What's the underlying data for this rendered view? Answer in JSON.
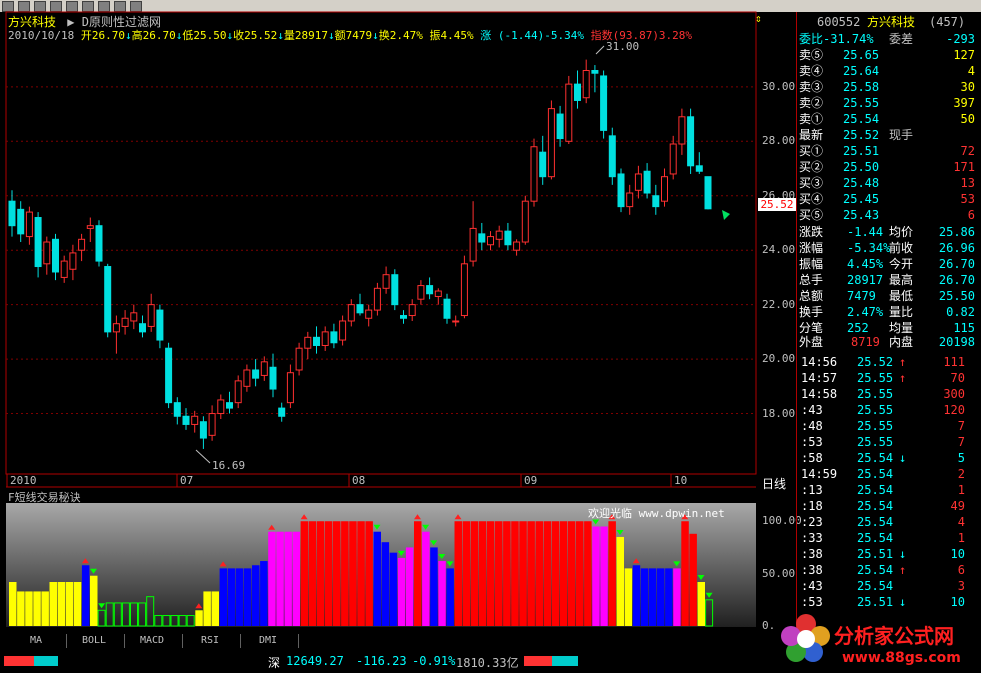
{
  "window": {
    "stock_name": "方兴科技",
    "formula": "D原则性过滤网"
  },
  "info_line": {
    "date": "2010/10/18",
    "open": "开26.70",
    "high": "高26.70",
    "low": "低25.50",
    "close": "收25.52",
    "volume": "量28917",
    "amount": "额7479",
    "turnover": "换2.47%",
    "amplitude": "振4.45%",
    "change": "涨 (-1.44)-5.34%",
    "index_label": "指数",
    "index_value": "(93.87)3.28%"
  },
  "price_axis": [
    "30.00",
    "28.00",
    "26.00",
    "24.00",
    "22.00",
    "20.00",
    "18.00"
  ],
  "price_marker": "25.52",
  "annotations": {
    "high": "31.00",
    "low": "16.69"
  },
  "date_axis": [
    "2010",
    "07",
    "08",
    "09",
    "10"
  ],
  "period_label": "日线",
  "indicator": {
    "title": "F短线交易秘诀",
    "watermark": "欢迎光临 www.dpwin.net",
    "axis": [
      "100.00",
      "50.00",
      "0."
    ]
  },
  "tabs": [
    "MA",
    "BOLL",
    "MACD",
    "RSI",
    "DMI"
  ],
  "panel": {
    "code": "600552",
    "name": "方兴科技",
    "count": "(457)",
    "weibi": "委比-31.74%",
    "weicha_label": "委差",
    "weicha": "-293",
    "sells": [
      {
        "label": "卖⑤",
        "price": "25.65",
        "vol": "127"
      },
      {
        "label": "卖④",
        "price": "25.64",
        "vol": "4"
      },
      {
        "label": "卖③",
        "price": "25.58",
        "vol": "30"
      },
      {
        "label": "卖②",
        "price": "25.55",
        "vol": "397"
      },
      {
        "label": "卖①",
        "price": "25.54",
        "vol": "50"
      }
    ],
    "latest_label": "最新",
    "latest": "25.52",
    "xianshou": "现手",
    "buys": [
      {
        "label": "买①",
        "price": "25.51",
        "vol": "72"
      },
      {
        "label": "买②",
        "price": "25.50",
        "vol": "171"
      },
      {
        "label": "买③",
        "price": "25.48",
        "vol": "13"
      },
      {
        "label": "买④",
        "price": "25.45",
        "vol": "53"
      },
      {
        "label": "买⑤",
        "price": "25.43",
        "vol": "6"
      }
    ],
    "stats": [
      [
        "涨跌",
        "-1.44",
        "均价",
        "25.86"
      ],
      [
        "涨幅",
        "-5.34%",
        "前收",
        "26.96"
      ],
      [
        "振幅",
        "4.45%",
        "今开",
        "26.70"
      ],
      [
        "总手",
        "28917",
        "最高",
        "26.70"
      ],
      [
        "总额",
        "7479",
        "最低",
        "25.50"
      ],
      [
        "换手",
        "2.47%",
        "量比",
        "0.82"
      ],
      [
        "分笔",
        "252",
        "均量",
        "115"
      ]
    ],
    "outer_label": "外盘",
    "outer": "8719",
    "inner_label": "内盘",
    "inner": "20198",
    "ticks": [
      {
        "t": "14:56",
        "p": "25.52",
        "a": "↑",
        "v": "111"
      },
      {
        "t": "14:57",
        "p": "25.55",
        "a": "↑",
        "v": "70"
      },
      {
        "t": "14:58",
        "p": "25.55",
        "a": "",
        "v": "300"
      },
      {
        "t": ":43",
        "p": "25.55",
        "a": "",
        "v": "120"
      },
      {
        "t": ":48",
        "p": "25.55",
        "a": "",
        "v": "7"
      },
      {
        "t": ":53",
        "p": "25.55",
        "a": "",
        "v": "7"
      },
      {
        "t": ":58",
        "p": "25.54",
        "a": "↓",
        "v": "5"
      },
      {
        "t": "14:59",
        "p": "25.54",
        "a": "",
        "v": "2"
      },
      {
        "t": ":13",
        "p": "25.54",
        "a": "",
        "v": "1"
      },
      {
        "t": ":18",
        "p": "25.54",
        "a": "",
        "v": "49"
      },
      {
        "t": ":23",
        "p": "25.54",
        "a": "",
        "v": "4"
      },
      {
        "t": ":33",
        "p": "25.54",
        "a": "",
        "v": "1"
      },
      {
        "t": ":38",
        "p": "25.51",
        "a": "↓",
        "v": "10"
      },
      {
        "t": ":38",
        "p": "25.54",
        "a": "↑",
        "v": "6"
      },
      {
        "t": ":43",
        "p": "25.54",
        "a": "",
        "v": "3"
      },
      {
        "t": ":53",
        "p": "25.51",
        "a": "↓",
        "v": "10"
      }
    ]
  },
  "status": {
    "market": "深",
    "index": "12649.27",
    "change": "-116.23",
    "pct": "-0.91%",
    "amount": "1810.33亿"
  },
  "logo": {
    "text": "分析家公式网",
    "url": "www.88gs.com"
  },
  "chart_data": {
    "type": "candlestick",
    "ylim": [
      16,
      31.5
    ],
    "candles": [
      [
        25.8,
        26.2,
        24.5,
        24.9
      ],
      [
        25.5,
        25.8,
        24.3,
        24.6
      ],
      [
        24.5,
        25.6,
        24.2,
        25.4
      ],
      [
        25.2,
        25.4,
        23.0,
        23.4
      ],
      [
        23.5,
        24.5,
        23.1,
        24.3
      ],
      [
        24.4,
        24.6,
        22.9,
        23.2
      ],
      [
        23.0,
        23.8,
        22.8,
        23.6
      ],
      [
        23.3,
        24.2,
        22.9,
        23.9
      ],
      [
        24.0,
        24.6,
        23.6,
        24.4
      ],
      [
        24.8,
        25.2,
        24.3,
        24.9
      ],
      [
        24.9,
        25.1,
        23.4,
        23.6
      ],
      [
        23.4,
        23.5,
        20.8,
        21.0
      ],
      [
        21.0,
        21.6,
        20.2,
        21.3
      ],
      [
        21.2,
        21.8,
        20.9,
        21.5
      ],
      [
        21.4,
        22.0,
        21.1,
        21.7
      ],
      [
        21.3,
        21.6,
        20.8,
        21.0
      ],
      [
        21.2,
        22.4,
        21.0,
        22.0
      ],
      [
        21.8,
        22.0,
        20.4,
        20.7
      ],
      [
        20.4,
        20.6,
        18.2,
        18.4
      ],
      [
        18.4,
        18.6,
        17.6,
        17.9
      ],
      [
        17.9,
        18.2,
        17.4,
        17.6
      ],
      [
        17.6,
        18.1,
        17.3,
        17.9
      ],
      [
        17.7,
        17.9,
        16.7,
        17.1
      ],
      [
        17.2,
        18.3,
        17.0,
        18.0
      ],
      [
        18.0,
        18.7,
        17.8,
        18.5
      ],
      [
        18.4,
        18.8,
        18.0,
        18.2
      ],
      [
        18.4,
        19.4,
        18.2,
        19.2
      ],
      [
        19.0,
        19.8,
        18.8,
        19.6
      ],
      [
        19.6,
        20.0,
        19.0,
        19.3
      ],
      [
        19.4,
        20.1,
        19.2,
        19.9
      ],
      [
        19.7,
        20.2,
        18.6,
        18.9
      ],
      [
        18.2,
        18.4,
        17.7,
        17.9
      ],
      [
        18.4,
        19.8,
        18.2,
        19.5
      ],
      [
        19.6,
        20.6,
        19.4,
        20.4
      ],
      [
        20.4,
        21.0,
        20.0,
        20.8
      ],
      [
        20.8,
        21.2,
        20.2,
        20.5
      ],
      [
        20.5,
        21.2,
        20.3,
        21.0
      ],
      [
        21.0,
        21.3,
        20.4,
        20.6
      ],
      [
        20.7,
        21.6,
        20.5,
        21.4
      ],
      [
        21.4,
        22.2,
        21.2,
        22.0
      ],
      [
        22.0,
        22.4,
        21.6,
        21.7
      ],
      [
        21.5,
        22.0,
        21.2,
        21.8
      ],
      [
        21.8,
        22.8,
        21.6,
        22.6
      ],
      [
        22.6,
        23.4,
        22.4,
        23.1
      ],
      [
        23.1,
        23.3,
        21.8,
        22.0
      ],
      [
        21.6,
        21.8,
        21.3,
        21.5
      ],
      [
        21.6,
        22.2,
        21.4,
        22.0
      ],
      [
        22.2,
        22.9,
        22.0,
        22.7
      ],
      [
        22.7,
        23.0,
        22.2,
        22.4
      ],
      [
        22.3,
        22.6,
        22.0,
        22.5
      ],
      [
        22.2,
        22.4,
        21.3,
        21.5
      ],
      [
        21.4,
        21.6,
        21.2,
        21.4
      ],
      [
        21.6,
        23.8,
        21.5,
        23.5
      ],
      [
        23.6,
        25.8,
        23.4,
        24.8
      ],
      [
        24.6,
        25.0,
        24.0,
        24.3
      ],
      [
        24.2,
        24.7,
        24.0,
        24.5
      ],
      [
        24.4,
        24.9,
        24.1,
        24.7
      ],
      [
        24.7,
        25.0,
        24.0,
        24.2
      ],
      [
        24.0,
        24.4,
        23.8,
        24.3
      ],
      [
        24.3,
        26.0,
        24.2,
        25.8
      ],
      [
        25.8,
        28.1,
        25.6,
        27.8
      ],
      [
        27.6,
        28.2,
        26.4,
        26.7
      ],
      [
        26.7,
        29.5,
        26.6,
        29.2
      ],
      [
        29.0,
        29.3,
        27.8,
        28.1
      ],
      [
        28.0,
        30.4,
        27.9,
        30.1
      ],
      [
        30.1,
        30.6,
        29.2,
        29.5
      ],
      [
        29.6,
        31.0,
        29.4,
        30.6
      ],
      [
        30.6,
        30.8,
        29.8,
        30.5
      ],
      [
        30.4,
        30.6,
        28.1,
        28.4
      ],
      [
        28.2,
        28.5,
        26.4,
        26.7
      ],
      [
        26.8,
        27.0,
        25.4,
        25.6
      ],
      [
        25.6,
        26.4,
        25.3,
        26.1
      ],
      [
        26.2,
        27.1,
        25.9,
        26.8
      ],
      [
        26.9,
        27.2,
        25.9,
        26.1
      ],
      [
        26.0,
        26.4,
        25.3,
        25.6
      ],
      [
        25.8,
        27.0,
        25.6,
        26.7
      ],
      [
        26.8,
        28.2,
        26.6,
        27.9
      ],
      [
        27.9,
        29.2,
        27.5,
        28.9
      ],
      [
        28.9,
        29.2,
        26.8,
        27.1
      ],
      [
        27.1,
        27.6,
        26.8,
        26.9
      ],
      [
        26.7,
        26.7,
        25.5,
        25.52
      ]
    ],
    "bars": {
      "values": [
        42,
        33,
        33,
        33,
        33,
        42,
        42,
        42,
        42,
        58,
        48,
        15,
        22,
        22,
        22,
        22,
        22,
        28,
        10,
        10,
        10,
        10,
        10,
        15,
        33,
        33,
        55,
        55,
        55,
        55,
        58,
        62,
        90,
        90,
        90,
        90,
        100,
        100,
        100,
        100,
        100,
        100,
        100,
        100,
        100,
        90,
        80,
        70,
        65,
        75,
        100,
        90,
        75,
        62,
        55,
        100,
        100,
        100,
        100,
        100,
        100,
        100,
        100,
        100,
        100,
        100,
        100,
        100,
        100,
        100,
        100,
        100,
        95,
        95,
        100,
        85,
        55,
        58,
        55,
        55,
        55,
        55,
        55,
        100,
        88,
        42,
        25
      ],
      "colors": [
        "yellow",
        "yellow",
        "yellow",
        "yellow",
        "yellow",
        "yellow",
        "yellow",
        "yellow",
        "yellow",
        "blue",
        "yellow",
        "green",
        "green",
        "green",
        "green",
        "green",
        "green",
        "green",
        "green",
        "green",
        "green",
        "green",
        "green",
        "yellow",
        "yellow",
        "yellow",
        "blue",
        "blue",
        "blue",
        "blue",
        "blue",
        "blue",
        "magenta",
        "magenta",
        "magenta",
        "magenta",
        "red",
        "red",
        "red",
        "red",
        "red",
        "red",
        "red",
        "red",
        "red",
        "blue",
        "blue",
        "blue",
        "magenta",
        "magenta",
        "red",
        "magenta",
        "blue",
        "magenta",
        "blue",
        "red",
        "red",
        "red",
        "red",
        "red",
        "red",
        "red",
        "red",
        "red",
        "red",
        "red",
        "red",
        "red",
        "red",
        "red",
        "red",
        "red",
        "magenta",
        "magenta",
        "red",
        "yellow",
        "yellow",
        "blue",
        "blue",
        "blue",
        "blue",
        "blue",
        "magenta",
        "red",
        "red",
        "yellow",
        "green"
      ]
    }
  }
}
